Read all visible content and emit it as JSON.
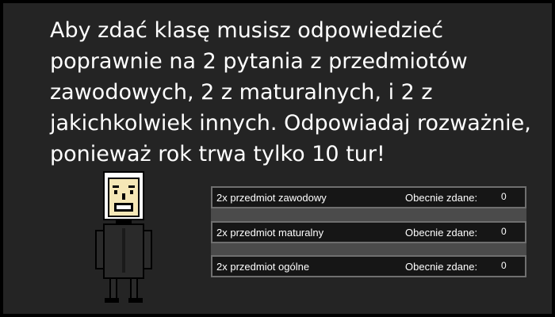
{
  "instructions": {
    "text": "Aby zdać klasę musisz odpowiedzieć poprawnie na 2 pytania z przedmiotów zawodowych, 2 z maturalnych, i 2 z jakichkolwiek innych. Odpowiadaj rozważnie, ponieważ rok trwa tylko 10 tur!"
  },
  "character": {
    "icon": "teacher-character-icon",
    "skin_color": "#f5e7b6",
    "robe_color": "#2a2a2a",
    "outline_color": "#000000",
    "hair_color": "#ffffff"
  },
  "requirements": {
    "status_label": "Obecnie zdane:",
    "items": [
      {
        "label": "2x przedmiot zawodowy",
        "passed": "0"
      },
      {
        "label": "2x przedmiot maturalny",
        "passed": "0"
      },
      {
        "label": "2x przedmiot ogólne",
        "passed": "0"
      }
    ]
  }
}
